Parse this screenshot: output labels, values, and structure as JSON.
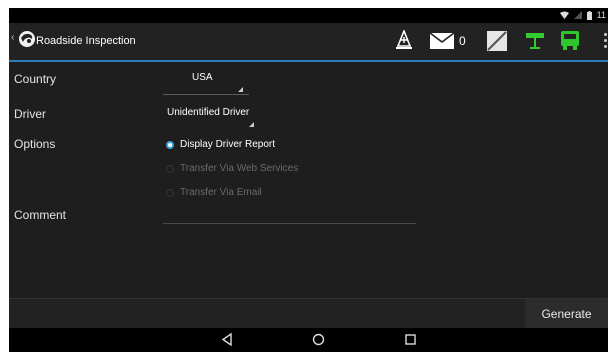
{
  "status_bar": {
    "icons": [
      "wifi-icon",
      "signal-icon",
      "battery-icon"
    ],
    "time": "11"
  },
  "action_bar": {
    "back_glyph": "‹",
    "title": "Roadside Inspection",
    "mail_count": "0",
    "icons": [
      "inspection-icon",
      "mail-icon",
      "status-icon",
      "connection-icon",
      "vehicle-icon",
      "overflow-menu-icon"
    ]
  },
  "form": {
    "country": {
      "label": "Country",
      "value": "USA"
    },
    "driver": {
      "label": "Driver",
      "value": "Unidentified Driver"
    },
    "options": {
      "label": "Options",
      "items": [
        {
          "label": "Display Driver Report",
          "selected": true,
          "enabled": true
        },
        {
          "label": "Transfer Via Web Services",
          "selected": false,
          "enabled": false
        },
        {
          "label": "Transfer Via Email",
          "selected": false,
          "enabled": false
        }
      ]
    },
    "comment": {
      "label": "Comment",
      "value": ""
    }
  },
  "bottom_bar": {
    "generate_label": "Generate"
  },
  "nav_bar": {
    "icons": [
      "back-nav-icon",
      "home-nav-icon",
      "recents-nav-icon"
    ]
  },
  "colors": {
    "accent": "#2a7fb8",
    "radio_selected": "#3aa4e0",
    "vehicle_green": "#2ec52e",
    "connection_green": "#33cc33"
  }
}
